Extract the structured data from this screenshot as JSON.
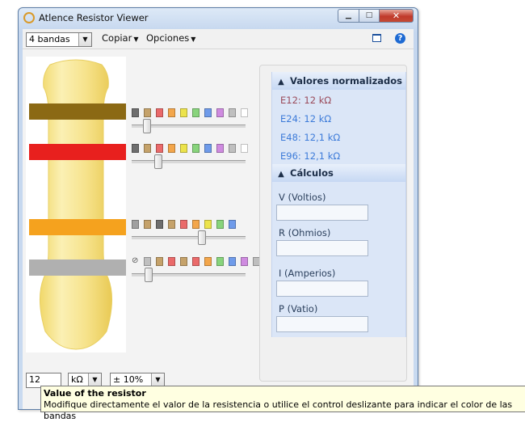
{
  "window": {
    "title": "Atlence Resistor Viewer",
    "minimize_glyph": "▁",
    "maximize_glyph": "□",
    "close_glyph": "✕"
  },
  "toolbar": {
    "band_select": "4 bandas",
    "copy_menu": "Copiar",
    "options_menu": "Opciones",
    "help_glyph": "?"
  },
  "colors": {
    "band1": "#8B6914",
    "band2": "#E8201E",
    "band3": "#F5A21E",
    "band4": "#B0B0B0",
    "body": "#f6e28a",
    "accent": "#3d7bd9"
  },
  "normalized": {
    "header": "Valores normalizados",
    "values": [
      {
        "label": "E12: 12 kΩ",
        "color": "#9a4a5a"
      },
      {
        "label": "E24: 12 kΩ",
        "color": "#3d7bd9"
      },
      {
        "label": "E48: 12,1 kΩ",
        "color": "#3d7bd9"
      },
      {
        "label": "E96: 12,1 kΩ",
        "color": "#3d7bd9"
      }
    ]
  },
  "calculations": {
    "header": "Cálculos",
    "voltage_label": "V (Voltios)",
    "resistance_label": "R (Ohmios)",
    "current_label": "I (Amperios)",
    "power_label": "P (Vatio)"
  },
  "value_bar": {
    "value": "12",
    "unit": "kΩ",
    "tolerance": "± 10%"
  },
  "tooltip": {
    "title": "Value of the resistor",
    "text": "Modifique directamente el valor de la resistencia o utilice el control deslizante para indicar el color de las bandas"
  },
  "band_sliders": {
    "digit_palette": [
      "#6e6e6e",
      "#c5a26a",
      "#ea6a6a",
      "#f3a64b",
      "#ece34b",
      "#88d47c",
      "#6f9bea",
      "#cf8be0",
      "#bfbfbf",
      "#ffffff"
    ],
    "multiplier_palette": [
      "#9f9f9f",
      "#c5a26a",
      "#6e6e6e",
      "#c5a26a",
      "#ea6a6a",
      "#f3a64b",
      "#ece34b",
      "#88d47c",
      "#6f9bea"
    ],
    "tolerance_palette": [
      "#bfbfbf",
      "#c5a26a",
      "#ea6a6a",
      "#c5a26a",
      "#ea6a6a",
      "#f3a64b",
      "#88d47c",
      "#6f9bea",
      "#cf8be0",
      "#bfbfbf"
    ],
    "no_color_glyph": "⊘"
  }
}
